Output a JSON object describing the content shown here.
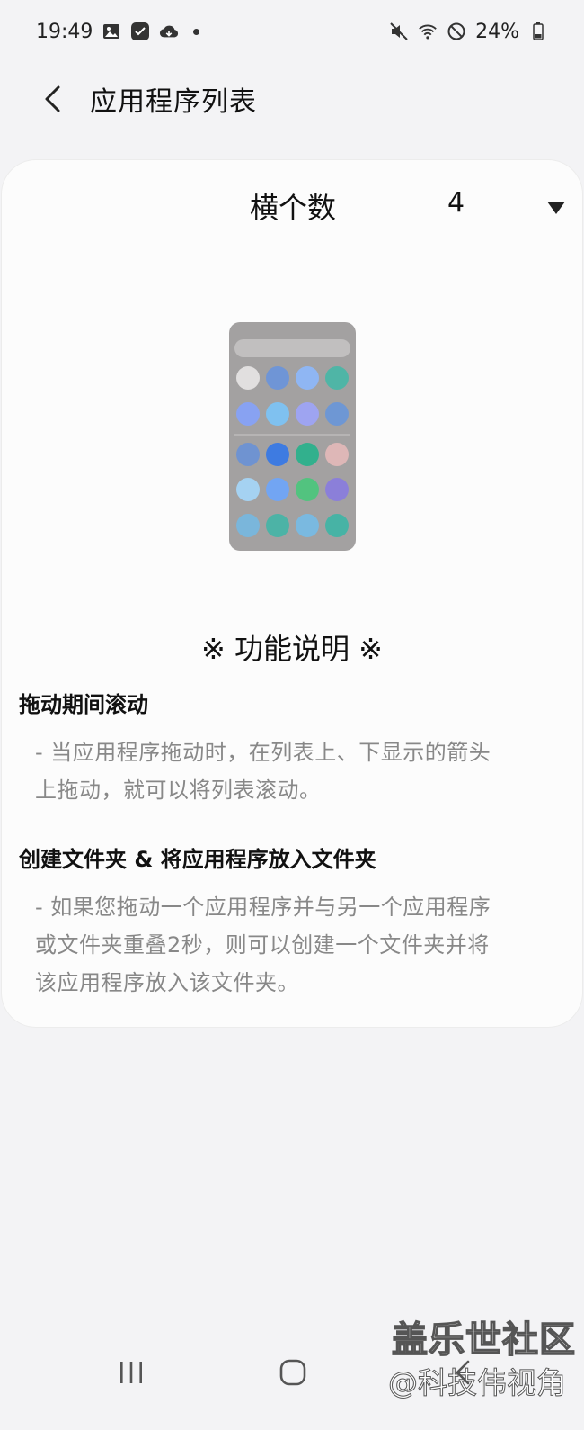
{
  "status_bar": {
    "time": "19:49",
    "battery": "24%",
    "icons": [
      "gallery-icon",
      "check-app-icon",
      "cloud-sync-icon",
      "mute-icon",
      "wifi-icon",
      "do-not-disturb-icon",
      "battery-icon"
    ]
  },
  "header": {
    "title": "应用程序列表"
  },
  "selector": {
    "label": "横个数",
    "value": "4"
  },
  "illustration": {
    "app_colors": [
      [
        "#e1dfdf",
        "#6f95d6",
        "#8fb6f3",
        "#4fb5a6"
      ],
      [
        "#88a2f2",
        "#7fc1f0",
        "#9ea4f1",
        "#6e97d4"
      ],
      [
        "#6f93d1",
        "#3e7be1",
        "#32b08d",
        "#deb7b7"
      ],
      [
        "#a5d2f2",
        "#72a5f3",
        "#52c37f",
        "#8b7fd9"
      ],
      [
        "#7ab6db",
        "#4cb3a6",
        "#7ab9e0",
        "#47b3a5"
      ]
    ]
  },
  "description": {
    "title": "※ 功能说明 ※",
    "sections": [
      {
        "title": "拖动期间滚动",
        "lines": [
          "- 当应用程序拖动时，在列表上、下显示的箭头",
          "上拖动，就可以将列表滚动。"
        ]
      },
      {
        "title": "创建文件夹 & 将应用程序放入文件夹",
        "lines": [
          "- 如果您拖动一个应用程序并与另一个应用程序",
          "或文件夹重叠2秒，则可以创建一个文件夹并将",
          "该应用程序放入该文件夹。"
        ]
      }
    ]
  },
  "watermark": {
    "line1": "盖乐世社区",
    "line2": "@科技伟视角"
  },
  "nav": {
    "icons": [
      "recent-apps-icon",
      "home-icon",
      "back-nav-icon"
    ]
  },
  "colors": {
    "background": "#f3f3f5",
    "card": "#fcfcfc",
    "body_text": "#888888",
    "phone_body": "#a3a1a1"
  }
}
